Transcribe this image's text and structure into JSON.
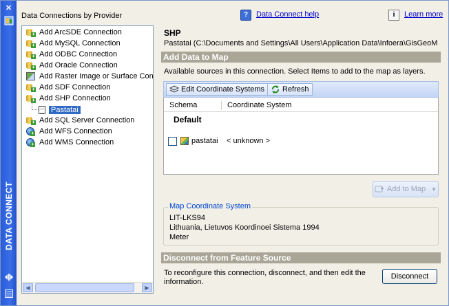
{
  "strip": {
    "close_glyph": "✕",
    "title": "DATA CONNECT"
  },
  "header": {
    "left_title": "Data Connections by Provider",
    "help_link": "Data Connect help",
    "learn_link": "Learn more"
  },
  "tree": {
    "items": [
      {
        "label": "Add ArcSDE Connection",
        "icon": "database-add-icon"
      },
      {
        "label": "Add MySQL Connection",
        "icon": "database-add-icon"
      },
      {
        "label": "Add ODBC Connection",
        "icon": "database-add-icon"
      },
      {
        "label": "Add Oracle Connection",
        "icon": "database-add-icon"
      },
      {
        "label": "Add Raster Image or Surface Connection",
        "icon": "raster-add-icon"
      },
      {
        "label": "Add SDF Connection",
        "icon": "database-add-icon"
      },
      {
        "label": "Add SHP Connection",
        "icon": "database-add-icon"
      },
      {
        "label": "Add SQL Server Connection",
        "icon": "database-add-icon"
      },
      {
        "label": "Add WFS Connection",
        "icon": "globe-add-icon"
      },
      {
        "label": "Add WMS Connection",
        "icon": "globe-add-icon"
      }
    ],
    "child": {
      "label": "Pastatai",
      "selected": true
    }
  },
  "panel": {
    "title": "SHP",
    "path": "Pastatai (C:\\Documents and Settings\\All Users\\Application Data\\Infoera\\GisGeoM",
    "add_section": "Add Data to Map",
    "available_text": "Available sources in this connection.  Select Items to add to the map as layers.",
    "toolbar": {
      "edit_cs": "Edit Coordinate Systems",
      "refresh": "Refresh"
    },
    "grid": {
      "col_schema": "Schema",
      "col_cs": "Coordinate System",
      "group": "Default",
      "row_name": "pastatai",
      "row_cs": "< unknown >",
      "row_checked": false
    },
    "add_to_map": "Add to Map",
    "mcs": {
      "legend": "Map Coordinate System",
      "code": "LIT-LKS94",
      "name": "Lithuania, Lietuvos Koordinoei Sistema 1994",
      "unit": "Meter"
    },
    "disconnect_section": "Disconnect from Feature Source",
    "disconnect_text": "To reconfigure this connection, disconnect, and then edit the information.",
    "disconnect_button": "Disconnect"
  },
  "colors": {
    "strip": "#2a5bd8",
    "section_header": "#a9a697",
    "selection": "#316ac5",
    "link": "#0000cc"
  }
}
